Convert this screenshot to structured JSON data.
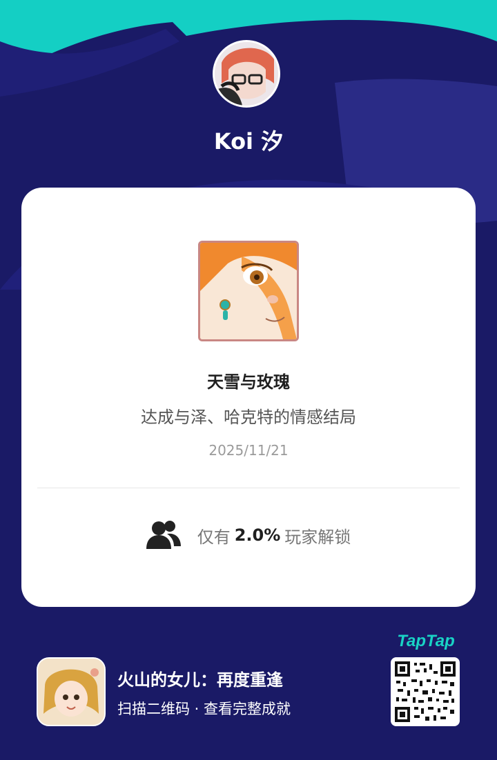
{
  "user": {
    "name": "Koi 汐"
  },
  "achievement": {
    "title": "天雪与玫瑰",
    "description": "达成与泽、哈克特的情感结局",
    "date": "2025/11/21",
    "stat_prefix": "仅有",
    "stat_percent": "2.0%",
    "stat_suffix": "玩家解锁"
  },
  "footer": {
    "game_name": "火山的女儿：再度重逢",
    "hint": "扫描二维码 · 查看完整成就",
    "brand": "TapTap"
  },
  "icons": {
    "avatar": "avatar",
    "achievement": "achievement-portrait",
    "users": "users-icon",
    "game": "game-app-icon",
    "qr": "qr-code"
  },
  "colors": {
    "background": "#1a1a66",
    "accent": "#19d3c5",
    "card": "#ffffff",
    "text_dark": "#1f1f1f",
    "text_muted": "#777777"
  }
}
